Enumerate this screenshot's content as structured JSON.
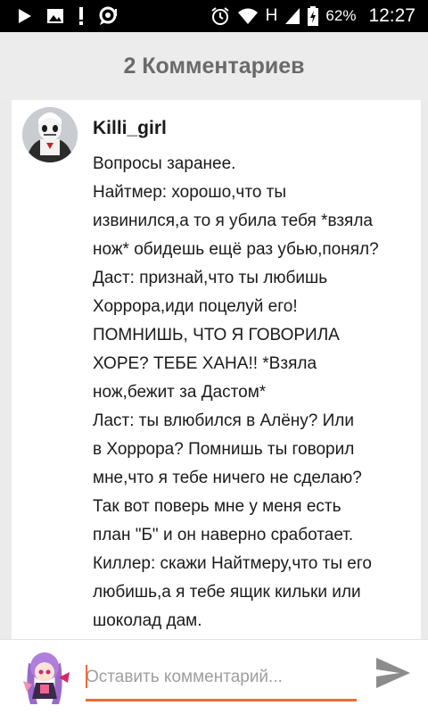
{
  "status_bar": {
    "network_type": "H",
    "battery_percent": "62%",
    "time": "12:27",
    "icons": [
      "play-store-notification-icon",
      "image-notification-icon",
      "alert-notification-icon",
      "chat-notification-icon",
      "alarm-clock-icon",
      "wifi-icon",
      "signal-icon",
      "battery-icon"
    ]
  },
  "header": {
    "title": "2 Комментариев"
  },
  "comment": {
    "author": "Killi_girl",
    "avatar_icon": "user-avatar",
    "lines": [
      "Вопросы заранее.",
      "Найтмер: хорошо,что ты",
      "извинился,а то я убила тебя *взяла",
      "нож* обидешь ещё раз убью,понял?",
      "Даст: признай,что ты любишь",
      "Хоррора,иди поцелуй его!",
      "ПОМНИШЬ, ЧТО Я ГОВОРИЛА",
      "ХОРЕ? ТЕБЕ ХАНА!! *Взяла",
      "нож,бежит за Дастом*",
      "Ласт: ты влюбился в Алёну? Или",
      "в Хоррора? Помнишь ты говорил",
      "мне,что я тебе ничего не сделаю?",
      "Так вот поверь мне у меня есть",
      "план \"Б\" и он наверно сработает.",
      "Киллер: скажи Найтмеру,что ты его",
      "любишь,а я тебе ящик кильки или",
      "шоколад дам."
    ]
  },
  "composer": {
    "placeholder": "Оставить комментарий...",
    "value": "",
    "send_icon": "send-icon",
    "accent_color": "#ee6a3b"
  }
}
